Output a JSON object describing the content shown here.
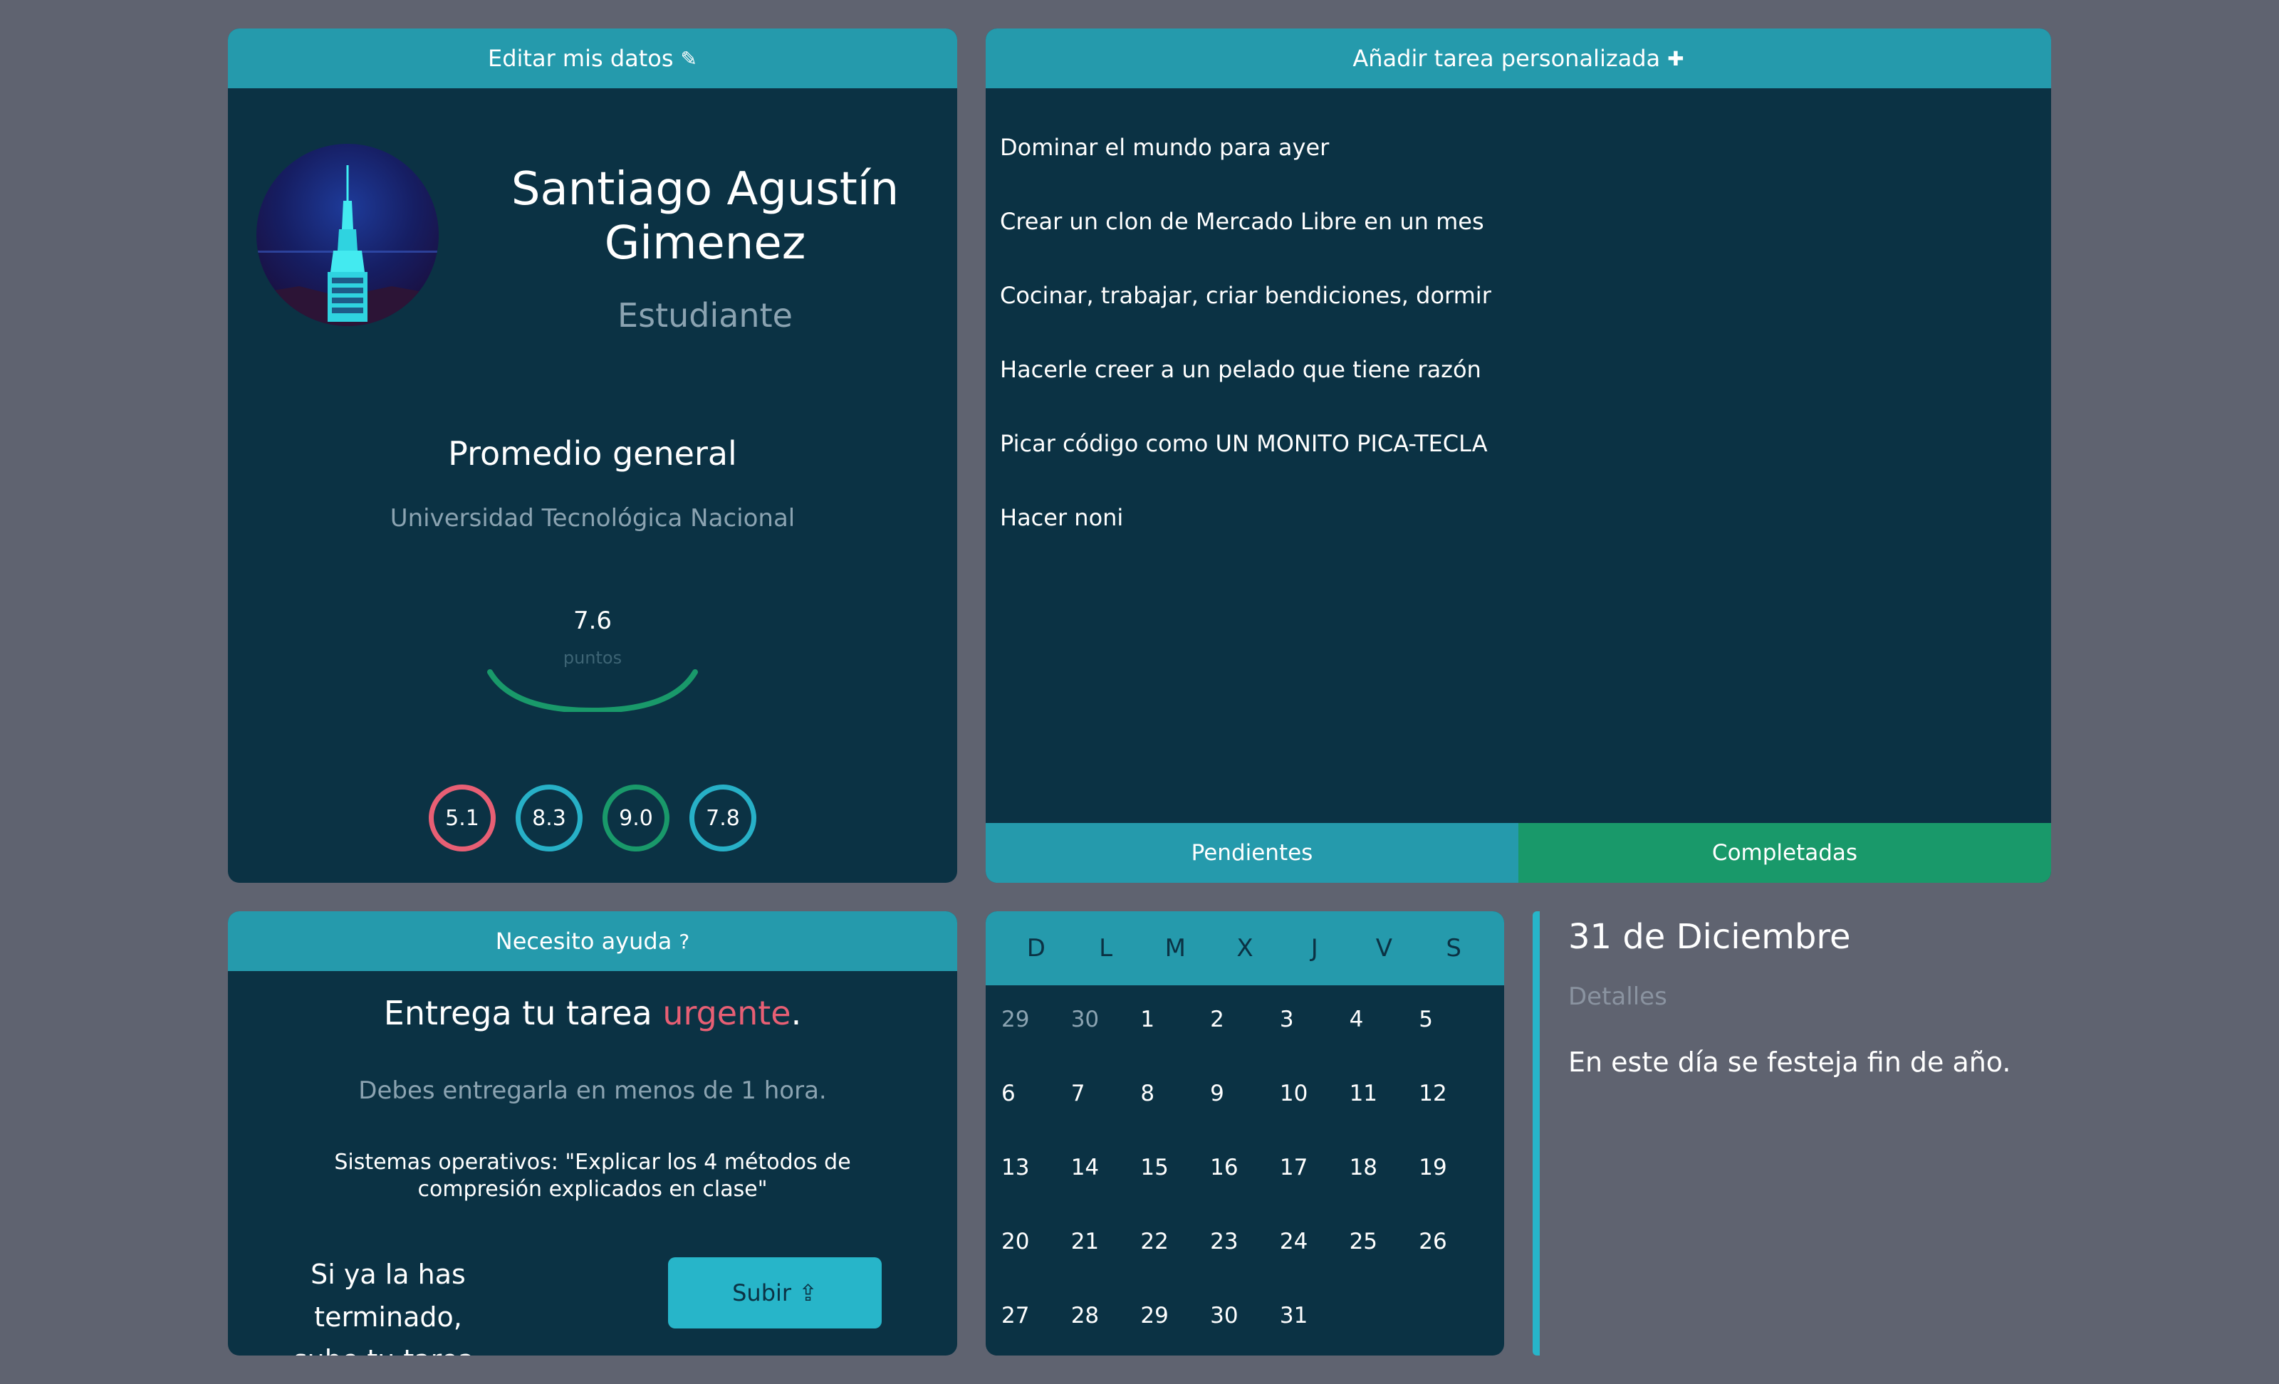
{
  "profile": {
    "header": "Editar mis datos",
    "name": "Santiago Agustín Gimenez",
    "role": "Estudiante",
    "average_title": "Promedio general",
    "university": "Universidad Tecnológica Nacional",
    "average_value": "7.6",
    "average_unit": "puntos",
    "average_fraction": 0.76,
    "grades": [
      {
        "value": "5.1",
        "color": "#e85f74"
      },
      {
        "value": "8.3",
        "color": "#27b0c7"
      },
      {
        "value": "9.0",
        "color": "#19996a"
      },
      {
        "value": "7.8",
        "color": "#27b0c7"
      }
    ]
  },
  "tasks": {
    "header": "Añadir tarea personalizada",
    "items": [
      "Dominar el mundo para ayer",
      "Crear un clon de Mercado Libre en un mes",
      "Cocinar, trabajar, criar bendiciones, dormir",
      "Hacerle creer a un pelado que tiene razón",
      "Picar código como UN MONITO PICA-TECLA",
      "Hacer noni"
    ],
    "tabs": [
      {
        "label": "Pendientes",
        "color": "#259aac"
      },
      {
        "label": "Completadas",
        "color": "#19996a"
      }
    ]
  },
  "help": {
    "header": "Necesito ayuda",
    "title_prefix": "Entrega tu tarea ",
    "title_highlight": "urgente",
    "title_suffix": ".",
    "subtitle": "Debes entregarla en menos de 1 hora.",
    "task": "Sistemas operativos: \"Explicar los 4 métodos de compresión explicados en clase\"",
    "cta_line1": "Si ya la has terminado,",
    "cta_line2": "sube tu tarea.",
    "button": "Subir"
  },
  "calendar": {
    "weekdays": [
      "D",
      "L",
      "M",
      "X",
      "J",
      "V",
      "S"
    ],
    "days": [
      {
        "d": "29",
        "muted": true
      },
      {
        "d": "30",
        "muted": true
      },
      {
        "d": "1"
      },
      {
        "d": "2"
      },
      {
        "d": "3"
      },
      {
        "d": "4"
      },
      {
        "d": "5"
      },
      {
        "d": "6"
      },
      {
        "d": "7"
      },
      {
        "d": "8"
      },
      {
        "d": "9"
      },
      {
        "d": "10"
      },
      {
        "d": "11"
      },
      {
        "d": "12"
      },
      {
        "d": "13"
      },
      {
        "d": "14"
      },
      {
        "d": "15"
      },
      {
        "d": "16"
      },
      {
        "d": "17"
      },
      {
        "d": "18"
      },
      {
        "d": "19"
      },
      {
        "d": "20"
      },
      {
        "d": "21"
      },
      {
        "d": "22"
      },
      {
        "d": "23"
      },
      {
        "d": "24"
      },
      {
        "d": "25"
      },
      {
        "d": "26"
      },
      {
        "d": "27"
      },
      {
        "d": "28"
      },
      {
        "d": "29"
      },
      {
        "d": "30"
      },
      {
        "d": "31"
      }
    ]
  },
  "detail": {
    "date": "31 de Diciembre",
    "label": "Detalles",
    "text": "En este día se festeja fin de año."
  },
  "icons": {
    "edit": "edit-icon",
    "add": "add-icon",
    "help": "help-icon",
    "upload": "upload-icon"
  }
}
